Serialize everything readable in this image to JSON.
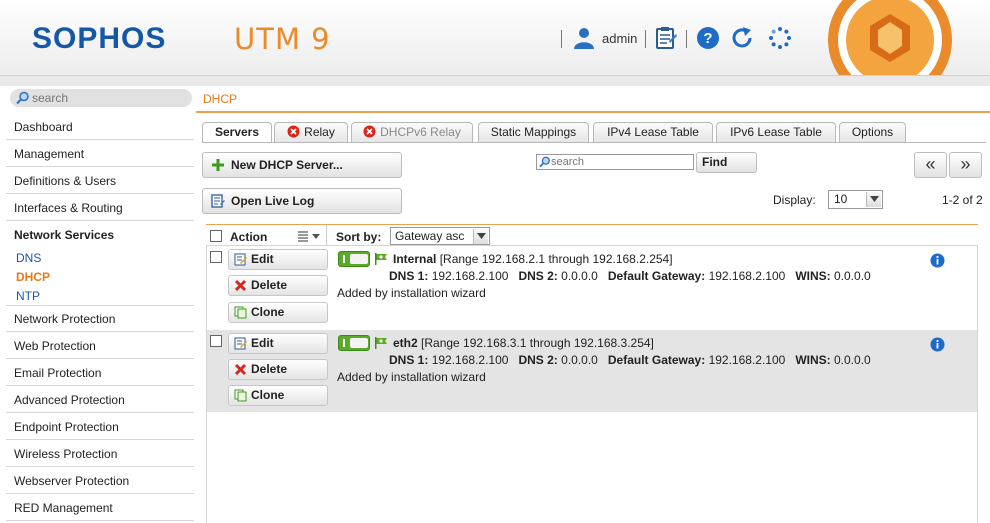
{
  "header": {
    "logo": "SOPHOS",
    "product": "UTM 9",
    "user": "admin",
    "icons": [
      "user-icon",
      "clipboard-icon",
      "help-icon",
      "refresh-icon",
      "spinner-icon"
    ],
    "accent": "#e98b2a",
    "brand": "#1456a8"
  },
  "sidebar": {
    "search_placeholder": "search",
    "items": [
      {
        "label": "Dashboard"
      },
      {
        "label": "Management"
      },
      {
        "label": "Definitions & Users"
      },
      {
        "label": "Interfaces & Routing"
      },
      {
        "label": "Network Services",
        "subitems": [
          "DNS",
          "DHCP",
          "NTP"
        ],
        "active_subitem": "DHCP"
      },
      {
        "label": "Network Protection"
      },
      {
        "label": "Web Protection"
      },
      {
        "label": "Email Protection"
      },
      {
        "label": "Advanced Protection"
      },
      {
        "label": "Endpoint Protection"
      },
      {
        "label": "Wireless Protection"
      },
      {
        "label": "Webserver Protection"
      },
      {
        "label": "RED Management"
      }
    ]
  },
  "main": {
    "breadcrumb": "DHCP",
    "tabs": [
      {
        "label": "Servers",
        "active": true
      },
      {
        "label": "Relay"
      },
      {
        "label": "DHCPv6 Relay",
        "disabled": true
      },
      {
        "label": "Static Mappings"
      },
      {
        "label": "IPv4 Lease Table"
      },
      {
        "label": "IPv6 Lease Table"
      },
      {
        "label": "Options"
      }
    ],
    "new_button": "New DHCP Server...",
    "log_button": "Open Live Log",
    "search_placeholder": "search",
    "find_button": "Find",
    "pager_prev": "«",
    "pager_next": "»",
    "display_label": "Display:",
    "display_value": "10",
    "count": "1-2 of 2",
    "table": {
      "action_header": "Action",
      "sortby_label": "Sort by:",
      "sortby_value": "Gateway asc",
      "row_buttons": {
        "edit": "Edit",
        "delete": "Delete",
        "clone": "Clone"
      },
      "rows": [
        {
          "name": "Internal",
          "range": "[Range 192.168.2.1 through 192.168.2.254]",
          "dns1_label": "DNS 1:",
          "dns1": "192.168.2.100",
          "dns2_label": "DNS 2:",
          "dns2": "0.0.0.0",
          "gw_label": "Default Gateway:",
          "gw": "192.168.2.100",
          "wins_label": "WINS:",
          "wins": "0.0.0.0",
          "comment": "Added by installation wizard",
          "enabled": true
        },
        {
          "name": "eth2",
          "range": "[Range 192.168.3.1 through 192.168.3.254]",
          "dns1_label": "DNS 1:",
          "dns1": "192.168.2.100",
          "dns2_label": "DNS 2:",
          "dns2": "0.0.0.0",
          "gw_label": "Default Gateway:",
          "gw": "192.168.2.100",
          "wins_label": "WINS:",
          "wins": "0.0.0.0",
          "comment": "Added by installation wizard",
          "enabled": true
        }
      ]
    }
  }
}
